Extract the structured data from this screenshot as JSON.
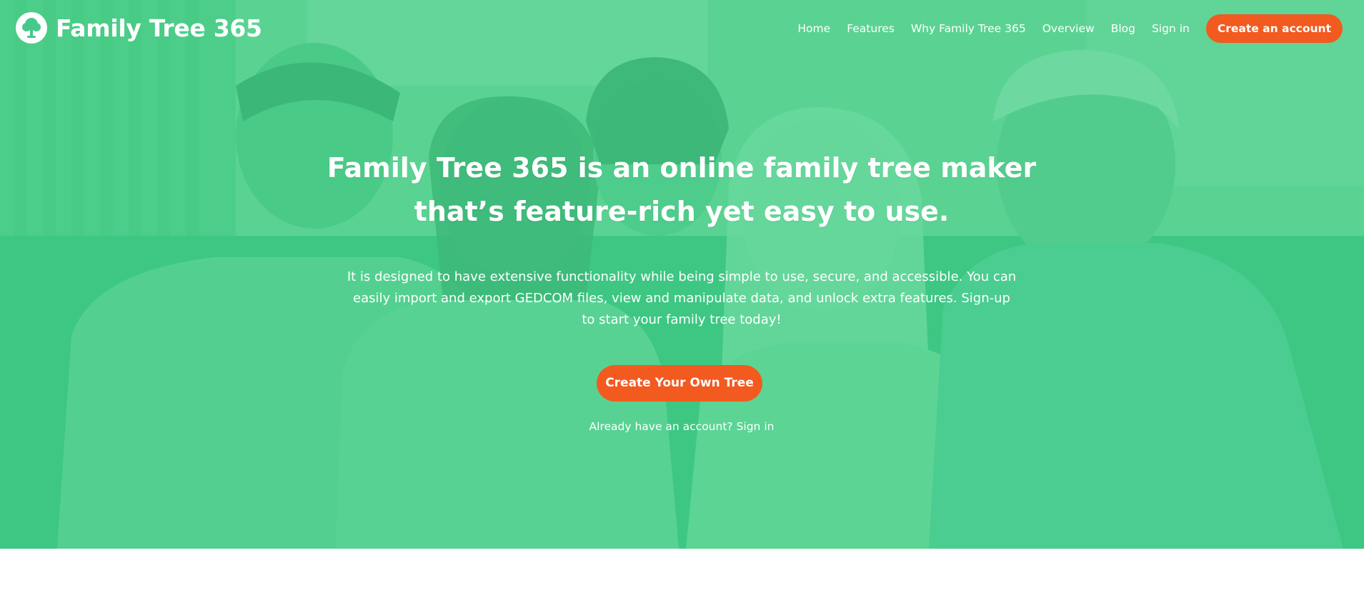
{
  "brand": {
    "name": "Family Tree 365",
    "icon": "tree-icon"
  },
  "nav": {
    "items": [
      {
        "label": "Home"
      },
      {
        "label": "Features"
      },
      {
        "label": "Why Family Tree 365"
      },
      {
        "label": "Overview"
      },
      {
        "label": "Blog"
      },
      {
        "label": "Sign in"
      }
    ],
    "cta_label": "Create an account"
  },
  "hero": {
    "headline_line1": "Family Tree 365 is an online family tree maker",
    "headline_line2": "that’s feature-rich yet easy to use.",
    "description": "It is designed to have extensive functionality while being simple to use, secure, and accessible. You can easily import and export GEDCOM files, view and manipulate data, and unlock extra features. Sign-up to start your family tree today!",
    "cta_label": "Create Your Own Tree",
    "account_prompt": "Already have an account?",
    "signin_link": "Sign in"
  },
  "colors": {
    "overlay_green": "#3ccd82",
    "accent_orange": "#f25a1f",
    "text_white": "#ffffff"
  }
}
